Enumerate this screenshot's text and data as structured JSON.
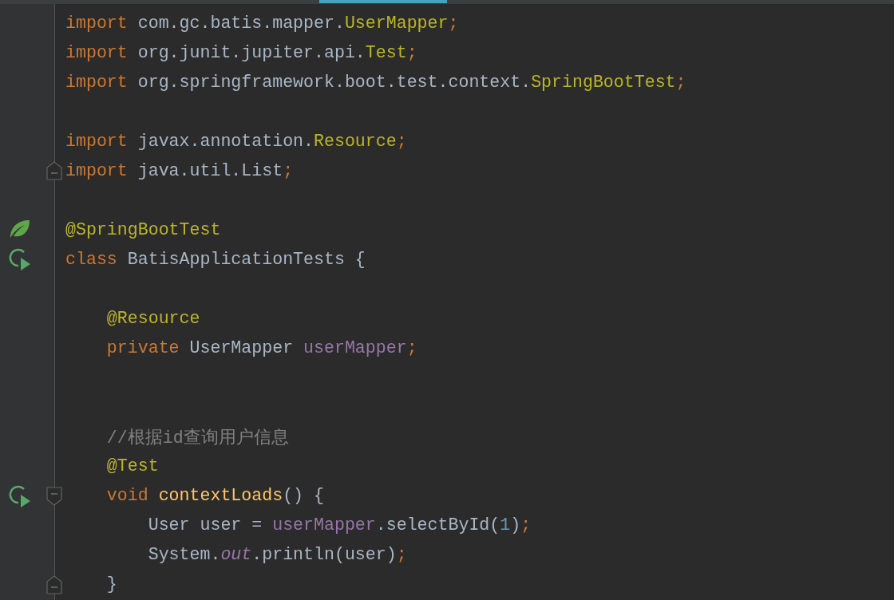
{
  "editor": {
    "lines": [
      {
        "tokens": [
          {
            "text": "import",
            "kind": "keyword"
          },
          {
            "text": " com.gc.batis.mapper.",
            "kind": "plain"
          },
          {
            "text": "UserMapper",
            "kind": "class"
          },
          {
            "text": ";",
            "kind": "keyword"
          }
        ]
      },
      {
        "tokens": [
          {
            "text": "import",
            "kind": "keyword"
          },
          {
            "text": " org.junit.jupiter.api.",
            "kind": "plain"
          },
          {
            "text": "Test",
            "kind": "class"
          },
          {
            "text": ";",
            "kind": "keyword"
          }
        ]
      },
      {
        "tokens": [
          {
            "text": "import",
            "kind": "keyword"
          },
          {
            "text": " org.springframework.boot.test.context.",
            "kind": "plain"
          },
          {
            "text": "SpringBootTest",
            "kind": "class"
          },
          {
            "text": ";",
            "kind": "keyword"
          }
        ]
      },
      {
        "blank": true
      },
      {
        "tokens": [
          {
            "text": "import",
            "kind": "keyword"
          },
          {
            "text": " javax.annotation.",
            "kind": "plain"
          },
          {
            "text": "Resource",
            "kind": "class"
          },
          {
            "text": ";",
            "kind": "keyword"
          }
        ]
      },
      {
        "fold_marker": {
          "kind": "end"
        },
        "tokens": [
          {
            "text": "import",
            "kind": "keyword"
          },
          {
            "text": " java.util.List",
            "kind": "plain"
          },
          {
            "text": ";",
            "kind": "keyword"
          }
        ]
      },
      {
        "blank": true
      },
      {
        "gutter_icon": {
          "kind": "spring"
        },
        "tokens": [
          {
            "text": "@SpringBootTest",
            "kind": "annotation"
          }
        ]
      },
      {
        "gutter_icon": {
          "kind": "run"
        },
        "tokens": [
          {
            "text": "class",
            "kind": "keyword"
          },
          {
            "text": " BatisApplicationTests {",
            "kind": "plain"
          }
        ]
      },
      {
        "blank": true
      },
      {
        "tokens": [
          {
            "text": "    @Resource",
            "kind": "annotation"
          }
        ]
      },
      {
        "tokens": [
          {
            "text": "    private",
            "kind": "keyword"
          },
          {
            "text": " UserMapper ",
            "kind": "plain"
          },
          {
            "text": "userMapper",
            "kind": "field"
          },
          {
            "text": ";",
            "kind": "keyword"
          }
        ]
      },
      {
        "blank": true
      },
      {
        "blank": true
      },
      {
        "tokens": [
          {
            "text": "    //根据id查询用户信息",
            "kind": "comment"
          }
        ]
      },
      {
        "tokens": [
          {
            "text": "    @Test",
            "kind": "annotation"
          }
        ]
      },
      {
        "gutter_icon": {
          "kind": "run"
        },
        "fold_marker": {
          "kind": "start"
        },
        "tokens": [
          {
            "text": "    void ",
            "kind": "keyword"
          },
          {
            "text": "contextLoads",
            "kind": "method"
          },
          {
            "text": "() {",
            "kind": "plain"
          }
        ]
      },
      {
        "tokens": [
          {
            "text": "        User user = ",
            "kind": "plain"
          },
          {
            "text": "userMapper",
            "kind": "field"
          },
          {
            "text": ".selectById(",
            "kind": "plain"
          },
          {
            "text": "1",
            "kind": "number"
          },
          {
            "text": ")",
            "kind": "plain"
          },
          {
            "text": ";",
            "kind": "keyword"
          }
        ]
      },
      {
        "tokens": [
          {
            "text": "        System.",
            "kind": "plain"
          },
          {
            "text": "out",
            "kind": "static"
          },
          {
            "text": ".println(user)",
            "kind": "plain"
          },
          {
            "text": ";",
            "kind": "keyword"
          }
        ]
      },
      {
        "fold_marker": {
          "kind": "end"
        },
        "tokens": [
          {
            "text": "    }",
            "kind": "plain"
          }
        ]
      }
    ]
  }
}
